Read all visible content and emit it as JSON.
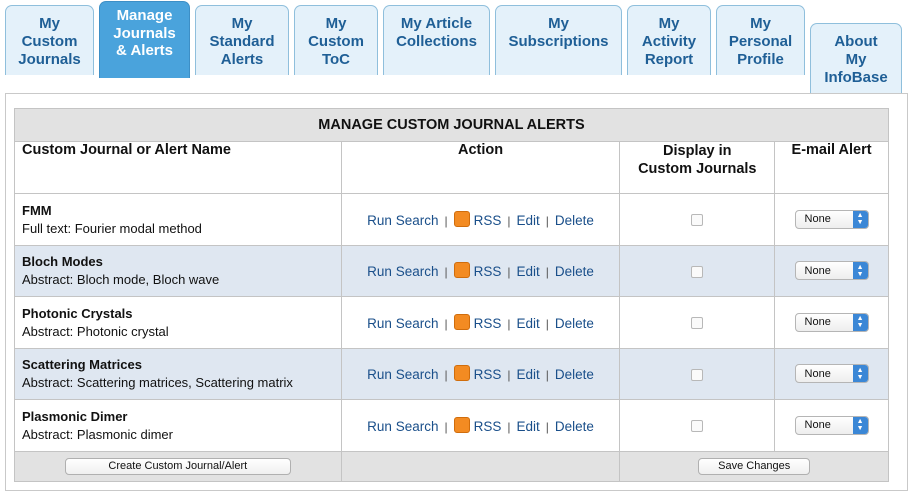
{
  "tabs": [
    {
      "label": "My\nCustom\nJournals",
      "active": false
    },
    {
      "label": "Manage\nJournals\n& Alerts",
      "active": true
    },
    {
      "label": "My\nStandard\nAlerts",
      "active": false
    },
    {
      "label": "My\nCustom\nToC",
      "active": false
    },
    {
      "label": "My Article\nCollections",
      "active": false
    },
    {
      "label": "My\nSubscriptions",
      "active": false
    },
    {
      "label": "My\nActivity\nReport",
      "active": false
    },
    {
      "label": "My\nPersonal\nProfile",
      "active": false
    },
    {
      "label": "About\nMy\nInfoBase",
      "active": false
    }
  ],
  "table": {
    "title": "MANAGE CUSTOM JOURNAL ALERTS",
    "headers": {
      "name": "Custom Journal or Alert Name",
      "action": "Action",
      "display": "Display in\nCustom Journals",
      "email": "E-mail Alert"
    },
    "actions": {
      "run": "Run Search",
      "rss": "RSS",
      "edit": "Edit",
      "delete": "Delete",
      "sep": "|"
    },
    "rows": [
      {
        "name": "FMM",
        "desc": "Full text: Fourier modal method",
        "display": false,
        "email": "None"
      },
      {
        "name": "Bloch Modes",
        "desc": "Abstract: Bloch mode, Bloch wave",
        "display": false,
        "email": "None"
      },
      {
        "name": "Photonic Crystals",
        "desc": "Abstract: Photonic crystal",
        "display": false,
        "email": "None"
      },
      {
        "name": "Scattering Matrices",
        "desc": "Abstract: Scattering matrices, Scattering matrix",
        "display": false,
        "email": "None"
      },
      {
        "name": "Plasmonic Dimer",
        "desc": "Abstract: Plasmonic dimer",
        "display": false,
        "email": "None"
      }
    ],
    "create_button": "Create Custom Journal/Alert",
    "save_button": "Save Changes"
  },
  "colors": {
    "tab_bg": "#e4f1fa",
    "tab_active_bg": "#4aa3dc",
    "tab_text": "#1f5f96",
    "row_alt_bg": "#dfe7f1",
    "link": "#1a4f8a",
    "rss": "#f38b22"
  }
}
